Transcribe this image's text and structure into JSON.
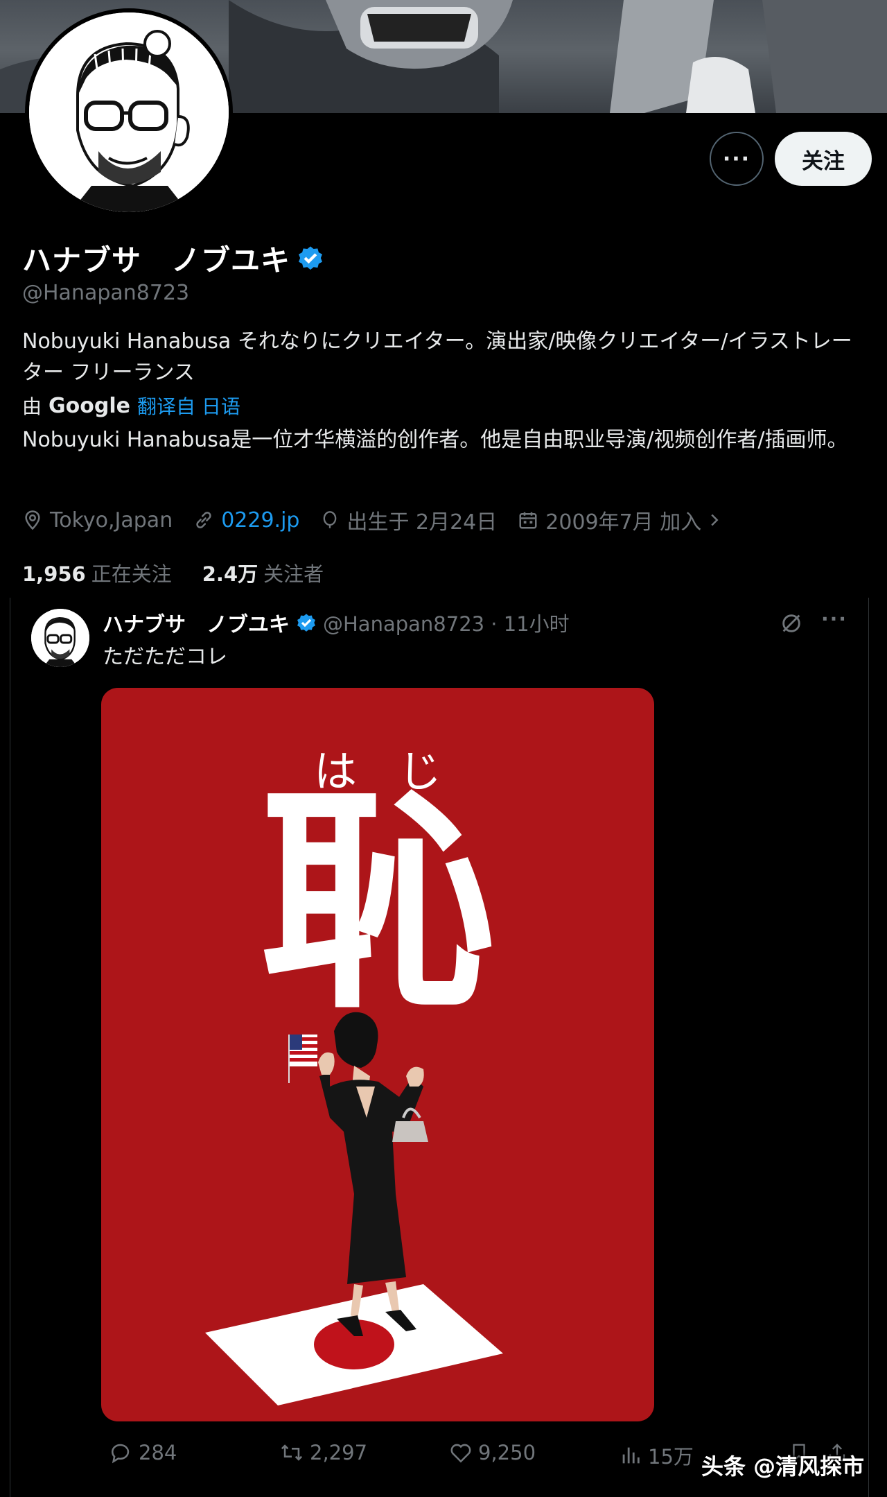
{
  "profile": {
    "display_name": "ハナブサ　ノブユキ",
    "handle": "@Hanapan8723",
    "bio": "Nobuyuki Hanabusa それなりにクリエイター。演出家/映像クリエイター/イラストレーター フリーランス",
    "translate": {
      "prefix": "由",
      "provider": "Google",
      "link": "翻译自 日语"
    },
    "bio_translated": "Nobuyuki Hanabusa是一位才华横溢的创作者。他是自由职业导演/视频创作者/插画师。",
    "location": "Tokyo,Japan",
    "website": "0229.jp",
    "birthday": "出生于 2月24日",
    "joined": "2009年7月 加入",
    "following_count": "1,956",
    "following_label": "正在关注",
    "followers_count": "2.4万",
    "followers_label": "关注者"
  },
  "actions": {
    "more": "···",
    "follow": "关注"
  },
  "tweet": {
    "name": "ハナブサ　ノブユキ",
    "meta": "@Hanapan8723 · 11小时",
    "text": "ただただコレ",
    "more": "···",
    "image": {
      "furigana": "はじ",
      "kanji": "恥"
    },
    "stats": {
      "replies": "284",
      "retweets": "2,297",
      "likes": "9,250",
      "views": "15万"
    }
  },
  "watermark": "头条 @清风探市",
  "colors": {
    "accent": "#1d9bf0",
    "poster_red": "#ad1519",
    "muted": "#71767b"
  },
  "icons": [
    "verified-badge-icon",
    "location-icon",
    "link-icon",
    "balloon-icon",
    "calendar-icon",
    "chevron-right-icon",
    "reply-icon",
    "retweet-icon",
    "like-icon",
    "views-icon",
    "bookmark-icon",
    "share-icon",
    "grok-icon"
  ]
}
